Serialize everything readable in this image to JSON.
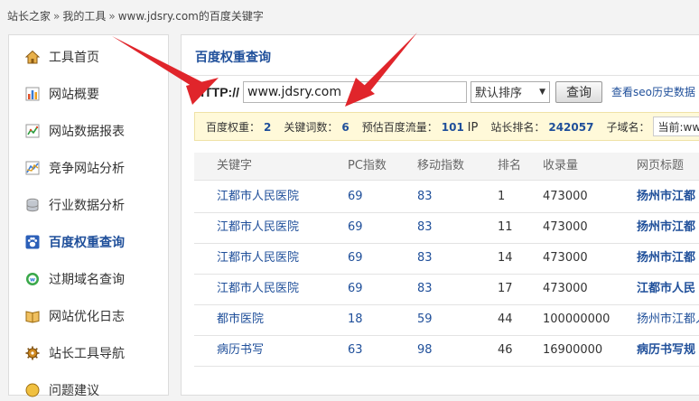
{
  "breadcrumb": [
    "站长之家",
    "我的工具",
    "www.jdsry.com的百度关键字"
  ],
  "sidebar": {
    "items": [
      {
        "label": "工具首页",
        "icon": "home-icon"
      },
      {
        "label": "网站概要",
        "icon": "bar-chart-icon"
      },
      {
        "label": "网站数据报表",
        "icon": "report-icon"
      },
      {
        "label": "竞争网站分析",
        "icon": "line-chart-icon"
      },
      {
        "label": "行业数据分析",
        "icon": "database-icon"
      },
      {
        "label": "百度权重查询",
        "icon": "paw-icon",
        "active": true
      },
      {
        "label": "过期域名查询",
        "icon": "domain-icon"
      },
      {
        "label": "网站优化日志",
        "icon": "book-icon"
      },
      {
        "label": "站长工具导航",
        "icon": "compass-icon"
      },
      {
        "label": "问题建议",
        "icon": "question-icon"
      }
    ]
  },
  "main": {
    "title": "百度权重查询",
    "query": {
      "http_label": "HTTP://",
      "url_value": "www.jdsry.com",
      "sort_selected": "默认排序",
      "query_button": "查询",
      "history_link": "查看seo历史数据"
    },
    "stats": {
      "weight_label": "百度权重：",
      "weight_value": "2",
      "keywords_label": "关键词数：",
      "keywords_value": "6",
      "traffic_label": "预估百度流量：",
      "traffic_value": "101",
      "traffic_unit": "IP",
      "rank_label": "站长排名：",
      "rank_value": "242057",
      "subdomain_label": "子域名：",
      "subdomain_value": "当前:www."
    },
    "table": {
      "headers": [
        "关键字",
        "PC指数",
        "移动指数",
        "排名",
        "收录量",
        "网页标题"
      ],
      "rows": [
        {
          "keyword": "江都市人民医院",
          "pc": "69",
          "mobile": "83",
          "rank": "1",
          "indexed": "473000",
          "title": "扬州市江都"
        },
        {
          "keyword": "江都市人民医院",
          "pc": "69",
          "mobile": "83",
          "rank": "11",
          "indexed": "473000",
          "title": "扬州市江都"
        },
        {
          "keyword": "江都市人民医院",
          "pc": "69",
          "mobile": "83",
          "rank": "14",
          "indexed": "473000",
          "title": "扬州市江都"
        },
        {
          "keyword": "江都市人民医院",
          "pc": "69",
          "mobile": "83",
          "rank": "17",
          "indexed": "473000",
          "title": "江都市人民"
        },
        {
          "keyword": "都市医院",
          "pc": "18",
          "mobile": "59",
          "rank": "44",
          "indexed": "100000000",
          "title": "扬州市江都人"
        },
        {
          "keyword": "病历书写",
          "pc": "63",
          "mobile": "98",
          "rank": "46",
          "indexed": "16900000",
          "title": "病历书写规"
        }
      ]
    }
  },
  "colors": {
    "accent": "#1f4f9a",
    "arrow": "#e0252b",
    "stats_bg": "#fff9d9"
  }
}
